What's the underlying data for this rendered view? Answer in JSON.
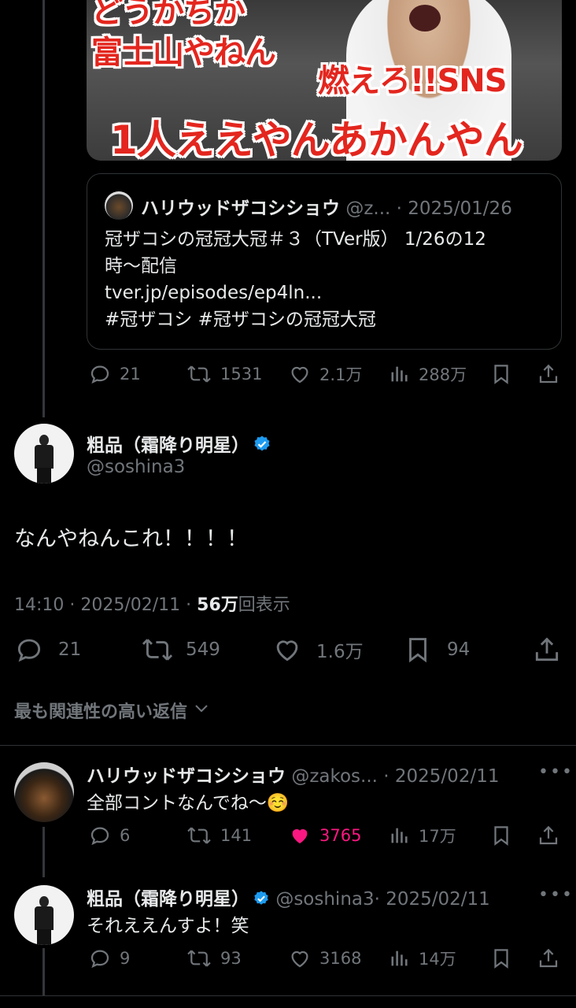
{
  "thumbnail": {
    "caption_line1": "どうかちか",
    "caption_line2": "富士山やねん",
    "caption_line3": "燃えろ!!SNS",
    "caption_line4": "1人ええやんあかんやん"
  },
  "quote": {
    "name": "ハリウッドザコシショウ",
    "handle": "@z...",
    "date": "· 2025/01/26",
    "text": "冠ザコシの冠冠大冠＃３（TVer版） 1/26の12\n時〜配信\ntver.jp/episodes/ep4ln...\n#冠ザコシ #冠ザコシの冠冠大冠"
  },
  "top_actions": {
    "replies": "21",
    "reposts": "1531",
    "likes": "2.1万",
    "views": "288万"
  },
  "main_tweet": {
    "name": "粗品（霜降り明星）",
    "handle": "@soshina3",
    "text": "なんやねんこれ！！！！",
    "time": "14:10 · 2025/02/11 · ",
    "views_count": "56万",
    "views_label": "回表示",
    "replies": "21",
    "reposts": "549",
    "likes": "1.6万",
    "bookmarks": "94"
  },
  "relevance_label": "最も関連性の高い返信",
  "replies": [
    {
      "name": "ハリウッドザコシショウ",
      "handle": "@zakos...",
      "date": "· 2025/02/11",
      "text": "全部コントなんでね〜☺️",
      "replies": "6",
      "reposts": "141",
      "likes": "3765",
      "views": "17万"
    },
    {
      "name": "粗品（霜降り明星）",
      "handle": "@soshina3",
      "date": "· 2025/02/11",
      "text": "それええんすよ！笑",
      "replies": "9",
      "reposts": "93",
      "likes": "3168",
      "views": "14万"
    }
  ],
  "more_glyph": "•••",
  "colors": {
    "background": "#000000",
    "muted": "#71767b",
    "like_active": "#f91880",
    "verified": "#1d9bf0"
  }
}
